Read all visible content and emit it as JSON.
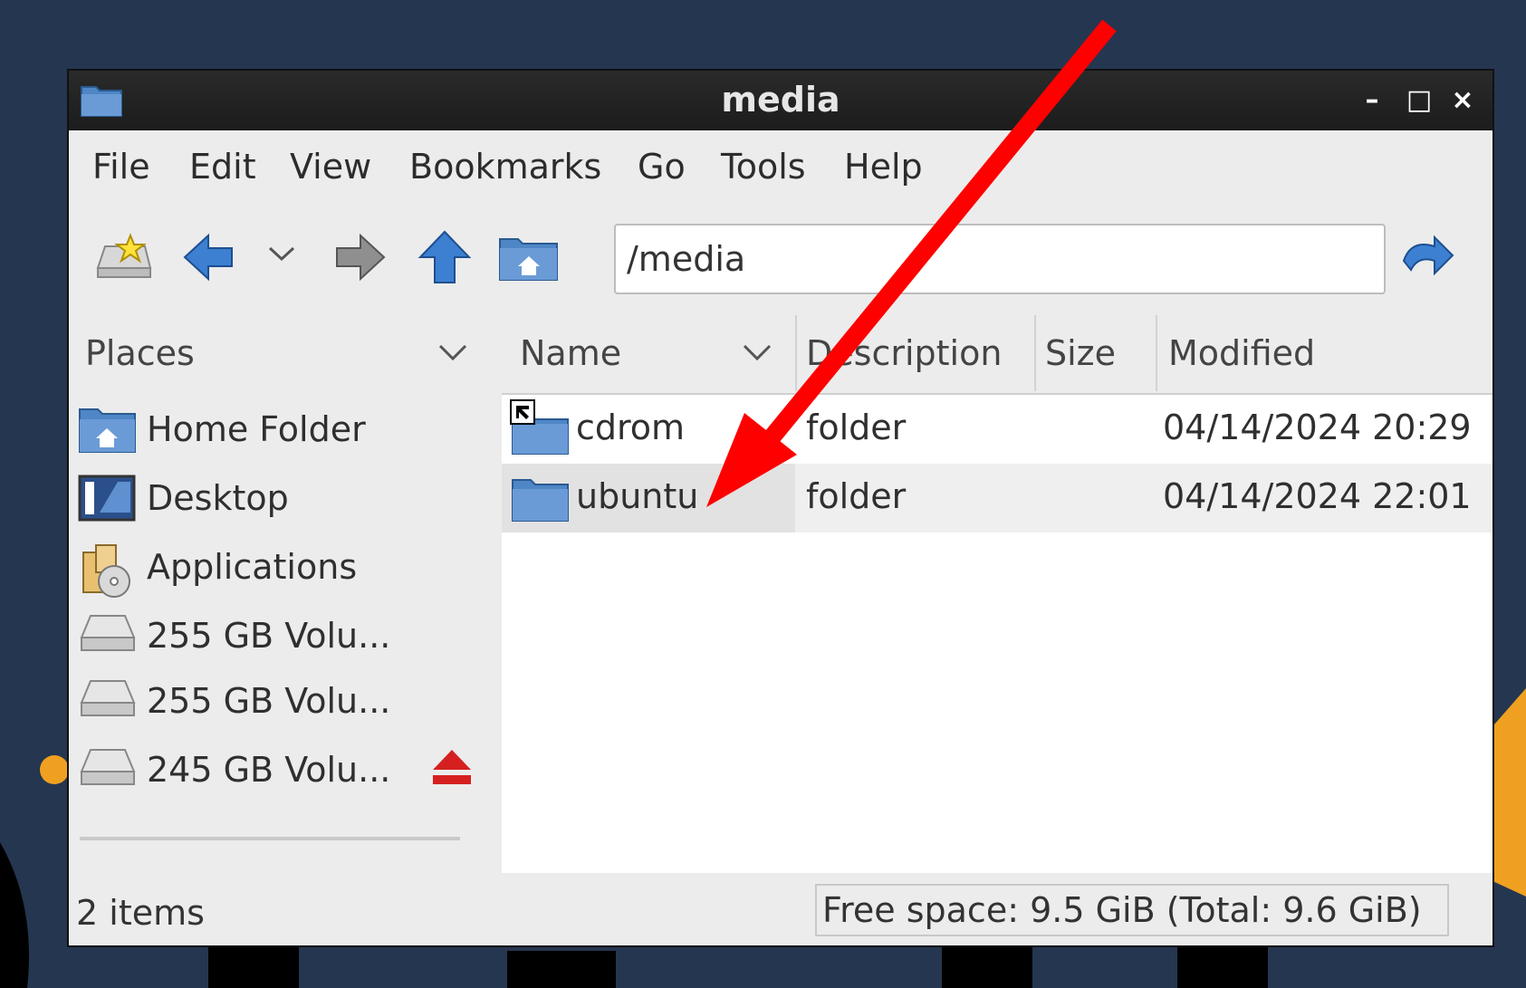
{
  "window": {
    "title": "media",
    "minimize_glyph": "–",
    "maximize_glyph": "□",
    "close_glyph": "×"
  },
  "menubar": {
    "items": [
      "File",
      "Edit",
      "View",
      "Bookmarks",
      "Go",
      "Tools",
      "Help"
    ]
  },
  "toolbar": {
    "path_value": "/media",
    "icons": [
      "new-tab-icon",
      "back-arrow-icon",
      "history-dropdown-icon",
      "forward-arrow-icon",
      "up-arrow-icon",
      "home-folder-icon",
      "go-arrow-icon"
    ]
  },
  "places": {
    "header": "Places",
    "items": [
      {
        "label": "Home Folder",
        "icon": "home-folder-icon"
      },
      {
        "label": "Desktop",
        "icon": "desktop-icon"
      },
      {
        "label": "Applications",
        "icon": "applications-icon"
      },
      {
        "label": "255 GB Volu...",
        "icon": "drive-icon"
      },
      {
        "label": "255 GB Volu...",
        "icon": "drive-icon"
      },
      {
        "label": "245 GB Volu...",
        "icon": "drive-icon",
        "eject": "eject-icon"
      }
    ]
  },
  "files": {
    "columns": [
      "Name",
      "Description",
      "Size",
      "Modified"
    ],
    "rows": [
      {
        "name": "cdrom",
        "description": "folder",
        "size": "",
        "modified": "04/14/2024 20:29",
        "icon": "symlink-folder-icon"
      },
      {
        "name": "ubuntu",
        "description": "folder",
        "size": "",
        "modified": "04/14/2024 22:01",
        "icon": "folder-icon"
      }
    ]
  },
  "status": {
    "items": "2 items",
    "free_space": "Free space: 9.5 GiB (Total: 9.6 GiB)"
  },
  "colors": {
    "desktop_bg": "#253650",
    "arrow": "#ff0000",
    "folder_blue": "#4f86c6"
  }
}
